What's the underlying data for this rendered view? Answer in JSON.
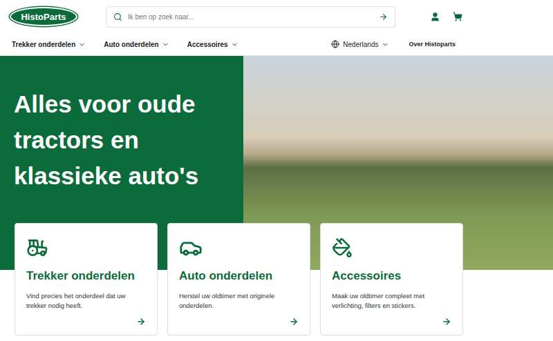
{
  "header": {
    "logo": "HistoParts",
    "search": {
      "placeholder": "Ik ben op zoek naar..."
    }
  },
  "nav": {
    "items": [
      {
        "label": "Trekker onderdelen",
        "dropdown": true
      },
      {
        "label": "Auto onderdelen",
        "dropdown": true
      },
      {
        "label": "Accessoires",
        "dropdown": true
      }
    ],
    "language": "Nederlands",
    "about": "Over Histoparts"
  },
  "hero": {
    "title_lines": [
      "Alles voor oude",
      "tractors en",
      "klassieke auto's"
    ]
  },
  "cards": [
    {
      "kind": "tractor",
      "title": "Trekker onderdelen",
      "text": "Vind precies het onderdeel dat uw trekker nodig heeft."
    },
    {
      "kind": "car",
      "title": "Auto onderdelen",
      "text": "Herstel uw oldtimer met originele onderdelen."
    },
    {
      "kind": "paint",
      "title": "Accessoires",
      "text": "Maak uw oldtimer compleet met verlichting, filters en stickers."
    }
  ]
}
